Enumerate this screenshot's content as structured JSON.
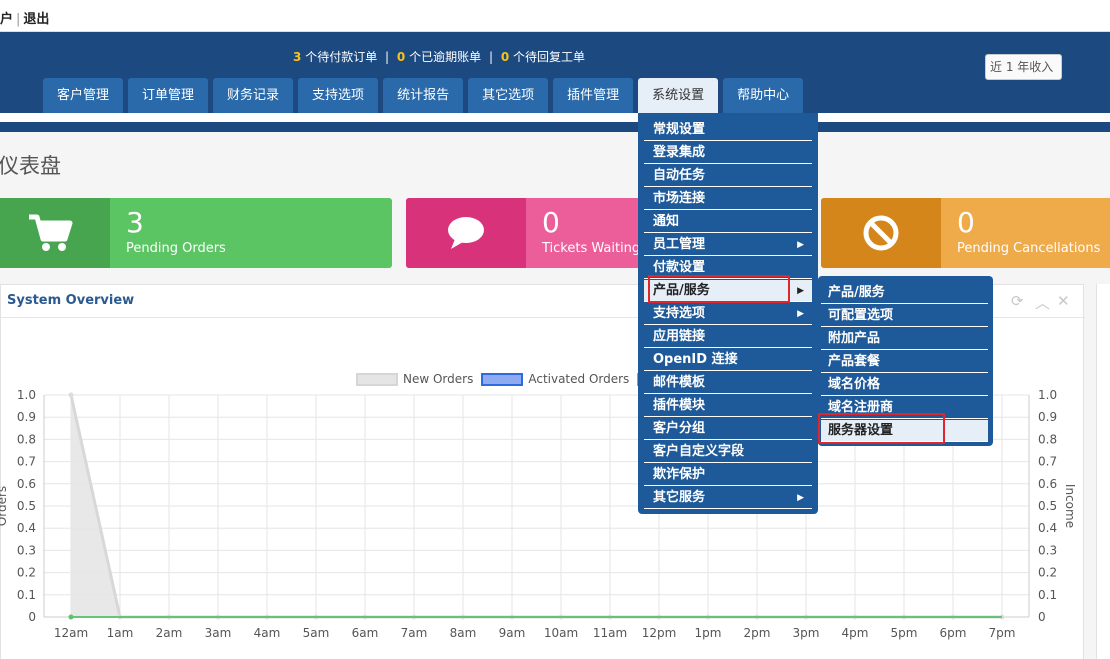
{
  "topbar": {
    "account_label": "户",
    "logout_label": "退出"
  },
  "alerts": {
    "unpaid_count": "3",
    "unpaid_text": "个待付款订单",
    "overdue_count": "0",
    "overdue_text": "个已逾期账单",
    "tickets_count": "0",
    "tickets_text": "个待回复工单",
    "separator": "|"
  },
  "nav": {
    "tabs": [
      "客户管理",
      "订单管理",
      "财务记录",
      "支持选项",
      "统计报告",
      "其它选项",
      "插件管理",
      "系统设置",
      "帮助中心"
    ],
    "active": "系统设置"
  },
  "page": {
    "title": "仪表盘"
  },
  "stats": [
    {
      "value": "3",
      "label": "Pending Orders",
      "icon": "cart-icon",
      "color": "#5bc463"
    },
    {
      "value": "0",
      "label": "Tickets Waiting",
      "icon": "chat-bubble-icon",
      "color": "#ec5e9a"
    },
    {
      "value": "0",
      "label": "Pending Cancellations",
      "icon": "no-entry-icon",
      "color": "#efaa4a"
    }
  ],
  "overview": {
    "title": "System Overview",
    "year_button": "近 1 年收入"
  },
  "menu": {
    "items": [
      "常规设置",
      "登录集成",
      "自动任务",
      "市场连接",
      "通知",
      "员工管理",
      "付款设置",
      "产品/服务",
      "支持选项",
      "应用链接",
      "OpenID 连接",
      "邮件模板",
      "插件模块",
      "客户分组",
      "客户自定义字段",
      "欺诈保护",
      "其它服务"
    ],
    "highlighted": "产品/服务",
    "with_arrow": [
      "员工管理",
      "产品/服务",
      "支持选项",
      "其它服务"
    ]
  },
  "submenu": {
    "items": [
      "产品/服务",
      "可配置选项",
      "附加产品",
      "产品套餐",
      "域名价格",
      "域名注册商",
      "服务器设置"
    ],
    "highlighted": "服务器设置"
  },
  "chart_data": {
    "type": "line",
    "x": [
      "12am",
      "1am",
      "2am",
      "3am",
      "4am",
      "5am",
      "6am",
      "7am",
      "8am",
      "9am",
      "10am",
      "11am",
      "12pm",
      "1pm",
      "2pm",
      "3pm",
      "4pm",
      "5pm",
      "6pm",
      "7pm"
    ],
    "series": [
      {
        "name": "New Orders",
        "values": [
          1,
          0,
          0,
          0,
          0,
          0,
          0,
          0,
          0,
          0,
          0,
          0,
          0,
          0,
          0,
          0,
          0,
          0,
          0,
          0
        ],
        "color": "#e5e5e5"
      },
      {
        "name": "Activated Orders",
        "values": [
          0,
          0,
          0,
          0,
          0,
          0,
          0,
          0,
          0,
          0,
          0,
          0,
          0,
          0,
          0,
          0,
          0,
          0,
          0,
          0
        ],
        "color": "#2c6be0"
      },
      {
        "values": [
          0,
          0,
          0,
          0,
          0,
          0,
          0,
          0,
          0,
          0,
          0,
          0,
          0,
          0,
          0,
          0,
          0,
          0,
          0,
          0
        ],
        "color": "#5bc463"
      }
    ],
    "y_ticks": [
      "0",
      "0.1",
      "0.2",
      "0.3",
      "0.4",
      "0.5",
      "0.6",
      "0.7",
      "0.8",
      "0.9",
      "1.0"
    ],
    "y2_ticks": [
      "0",
      "0.1",
      "0.2",
      "0.3",
      "0.4",
      "0.5",
      "0.6",
      "0.7",
      "0.8",
      "0.9",
      "1.0"
    ],
    "ylabel": "Orders",
    "y2label": "Income",
    "ylim": [
      0,
      1
    ],
    "grid": true,
    "legend": "top-center"
  }
}
